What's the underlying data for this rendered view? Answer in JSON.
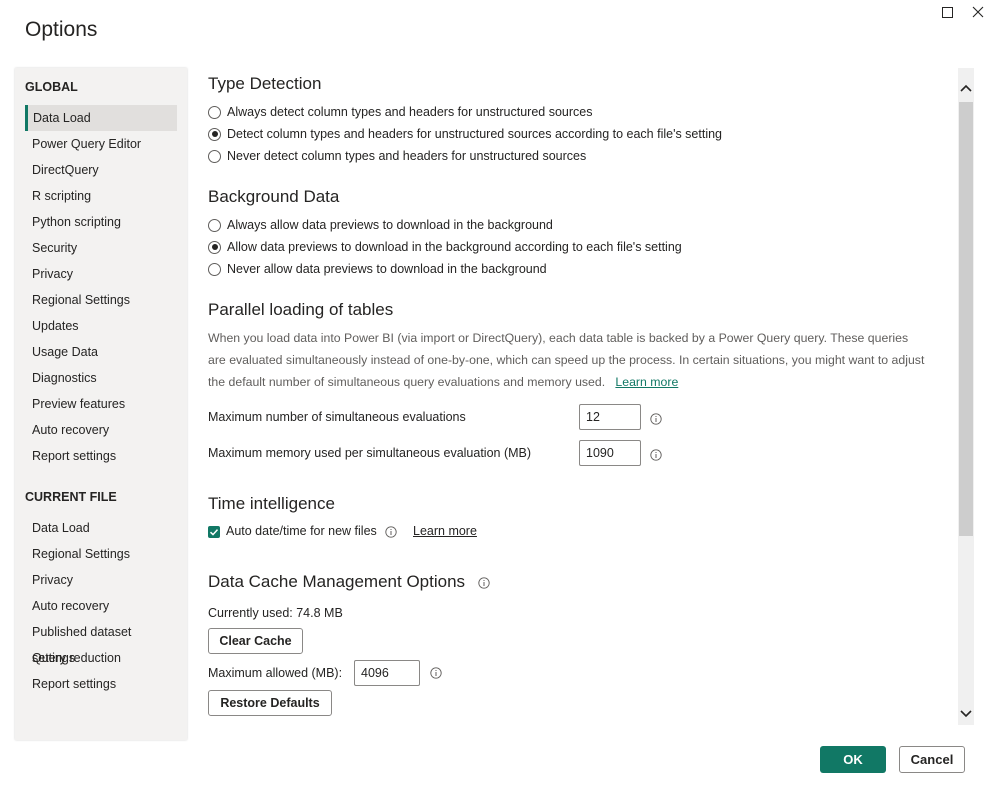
{
  "dialog": {
    "title": "Options"
  },
  "window_controls": {
    "maximize_icon": "maximize-icon",
    "close_icon": "close-icon"
  },
  "sidebar": {
    "global_header": "GLOBAL",
    "global_items": [
      {
        "label": "Data Load",
        "active": true
      },
      {
        "label": "Power Query Editor"
      },
      {
        "label": "DirectQuery"
      },
      {
        "label": "R scripting"
      },
      {
        "label": "Python scripting"
      },
      {
        "label": "Security"
      },
      {
        "label": "Privacy"
      },
      {
        "label": "Regional Settings"
      },
      {
        "label": "Updates"
      },
      {
        "label": "Usage Data"
      },
      {
        "label": "Diagnostics"
      },
      {
        "label": "Preview features"
      },
      {
        "label": "Auto recovery"
      },
      {
        "label": "Report settings"
      }
    ],
    "current_header": "CURRENT FILE",
    "current_items": [
      {
        "label": "Data Load"
      },
      {
        "label": "Regional Settings"
      },
      {
        "label": "Privacy"
      },
      {
        "label": "Auto recovery"
      },
      {
        "label": "Published dataset settings"
      },
      {
        "label": "Query reduction"
      },
      {
        "label": "Report settings"
      }
    ]
  },
  "type_detection": {
    "heading": "Type Detection",
    "options": [
      {
        "label": "Always detect column types and headers for unstructured sources",
        "checked": false
      },
      {
        "label": "Detect column types and headers for unstructured sources according to each file's setting",
        "checked": true
      },
      {
        "label": "Never detect column types and headers for unstructured sources",
        "checked": false
      }
    ]
  },
  "background_data": {
    "heading": "Background Data",
    "options": [
      {
        "label": "Always allow data previews to download in the background",
        "checked": false
      },
      {
        "label": "Allow data previews to download in the background according to each file's setting",
        "checked": true
      },
      {
        "label": "Never allow data previews to download in the background",
        "checked": false
      }
    ]
  },
  "parallel_loading": {
    "heading": "Parallel loading of tables",
    "description": "When you load data into Power BI (via import or DirectQuery), each data table is backed by a Power Query query. These queries are evaluated simultaneously instead of one-by-one, which can speed up the process. In certain situations, you might want to adjust the default number of simultaneous query evaluations and memory used.",
    "learn_more": "Learn more",
    "max_evaluations_label": "Maximum number of simultaneous evaluations",
    "max_evaluations_value": "12",
    "max_memory_label": "Maximum memory used per simultaneous evaluation (MB)",
    "max_memory_value": "1090"
  },
  "time_intelligence": {
    "heading": "Time intelligence",
    "auto_datetime_label": "Auto date/time for new files",
    "auto_datetime_checked": true,
    "learn_more": "Learn more"
  },
  "data_cache": {
    "heading": "Data Cache Management Options",
    "currently_used": "Currently used: 74.8 MB",
    "clear_cache_label": "Clear Cache",
    "max_allowed_label": "Maximum allowed (MB):",
    "max_allowed_value": "4096",
    "restore_defaults_label": "Restore Defaults"
  },
  "footer": {
    "ok_label": "OK",
    "cancel_label": "Cancel"
  },
  "colors": {
    "accent": "#117865",
    "active_nav_bg": "#e1dfdd",
    "sidebar_bg": "#f3f2f1"
  }
}
